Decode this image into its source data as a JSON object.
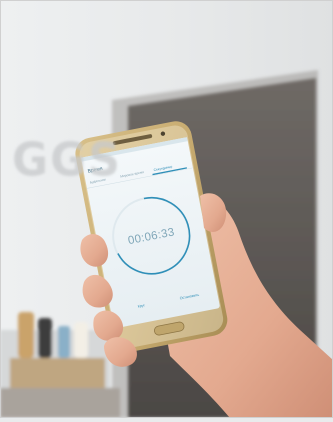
{
  "background_sign": {
    "text": "GGS"
  },
  "phone": {
    "app_title": "Время",
    "tabs": [
      "Будильник",
      "Мировое время",
      "Секундомер"
    ],
    "active_tab_index": 2,
    "stopwatch_time": "00:06:33",
    "buttons": {
      "left": "Круг",
      "right": "Остановить"
    },
    "accent_color": "#2f8fb8"
  }
}
